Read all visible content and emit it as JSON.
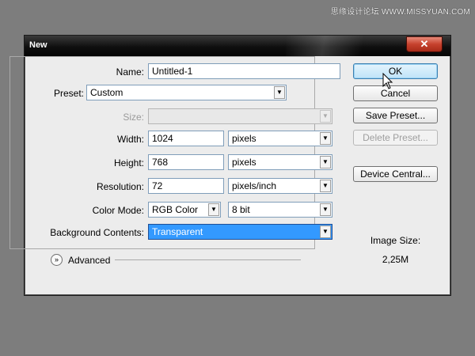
{
  "watermark": "思缘设计论坛 WWW.MISSYUAN.COM",
  "window": {
    "title": "New",
    "close_glyph": "✕"
  },
  "form": {
    "name_label": "Name:",
    "name_value": "Untitled-1",
    "preset_label": "Preset:",
    "preset_value": "Custom",
    "size_label": "Size:",
    "size_value": "",
    "width_label": "Width:",
    "width_value": "1024",
    "width_unit": "pixels",
    "height_label": "Height:",
    "height_value": "768",
    "height_unit": "pixels",
    "resolution_label": "Resolution:",
    "resolution_value": "72",
    "resolution_unit": "pixels/inch",
    "color_mode_label": "Color Mode:",
    "color_mode_value": "RGB Color",
    "bit_depth_value": "8 bit",
    "background_label": "Background Contents:",
    "background_value": "Transparent",
    "advanced_label": "Advanced"
  },
  "buttons": {
    "ok": "OK",
    "cancel": "Cancel",
    "save_preset": "Save Preset...",
    "delete_preset": "Delete Preset...",
    "device_central": "Device Central..."
  },
  "image_size": {
    "label": "Image Size:",
    "value": "2,25M"
  },
  "colors": {
    "selection": "#3399ff",
    "primary_button": "#bfe3f8",
    "titlebar": "#0f0f0f"
  }
}
